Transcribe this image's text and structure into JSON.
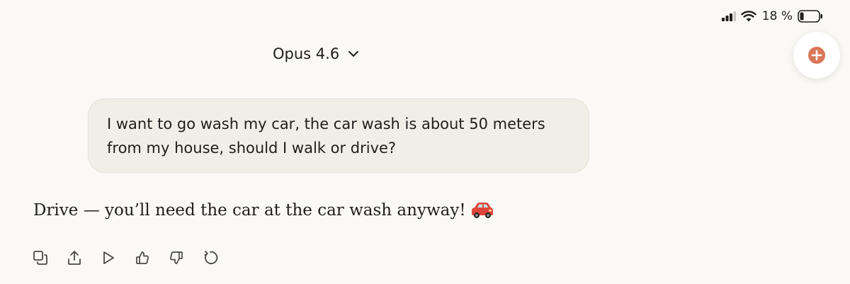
{
  "status_bar": {
    "battery_text": "18 %",
    "icons": [
      "signal-icon",
      "wifi-icon",
      "battery-icon"
    ]
  },
  "header": {
    "model_name": "Opus 4.6",
    "model_dropdown_icon": "chevron-down-icon",
    "new_chat_icon": "plus-icon",
    "accent_color": "#d97757"
  },
  "conversation": {
    "user_message": {
      "line1": "I want to go wash my car, the car wash is about 50 meters",
      "line2": "from my house, should I walk or drive?"
    },
    "assistant_message": {
      "text": "Drive — you’ll need the car at the car wash anyway!",
      "emoji_icon": "car-icon"
    }
  },
  "actions": [
    {
      "name": "copy-icon"
    },
    {
      "name": "share-icon"
    },
    {
      "name": "play-icon"
    },
    {
      "name": "thumbs-up-icon"
    },
    {
      "name": "thumbs-down-icon"
    },
    {
      "name": "retry-icon"
    }
  ],
  "colors": {
    "background": "#faf9f5",
    "bubble": "#f0eee6",
    "text": "#1f1e1c",
    "icon": "#4a4844"
  }
}
